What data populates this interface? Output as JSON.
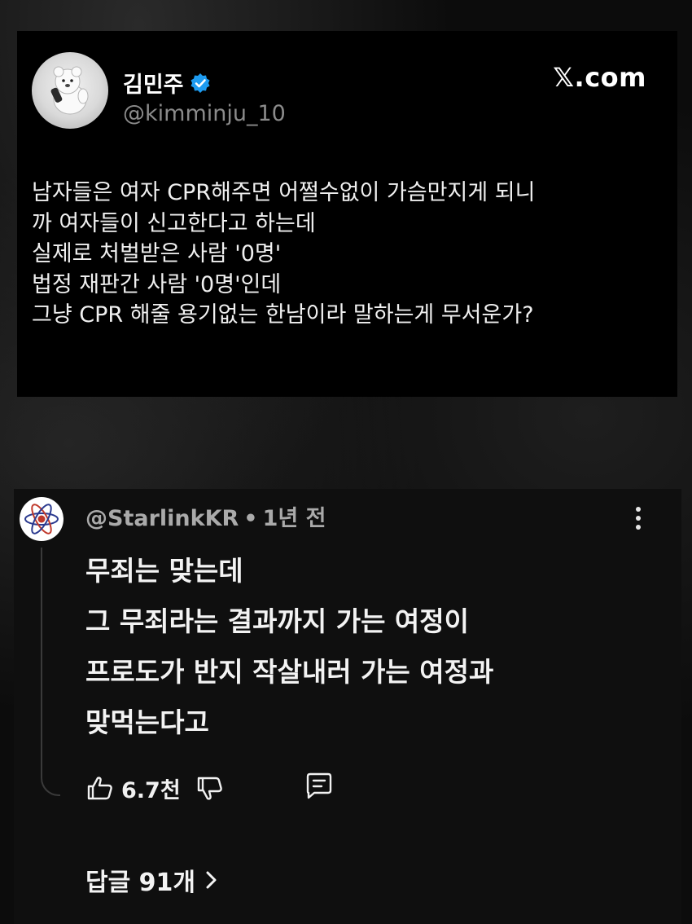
{
  "tweet": {
    "author_name": "김민주",
    "author_handle": "@kimminju_10",
    "source": "𝕏.com",
    "lines": [
      "남자들은 여자 CPR해주면 어쩔수없이 가슴만지게 되니",
      "까 여자들이 신고한다고 하는데",
      "실제로 처벌받은 사람 '0명'",
      "법정 재판간 사람 '0명'인데",
      "그냥 CPR 해줄 용기없는 한남이라 말하는게 무서운가?"
    ],
    "verified_icon": "verified-badge-icon",
    "verified_color": "#1d9bf0"
  },
  "comment": {
    "author": "@StarlinkKR",
    "separator": "•",
    "time": "1년 전",
    "lines": [
      "무죄는 맞는데",
      "그 무죄라는 결과까지 가는 여정이",
      "프로도가 반지 작살내러 가는 여정과",
      "맞먹는다고"
    ],
    "likes": "6.7천",
    "replies_label": "답글 91개"
  }
}
